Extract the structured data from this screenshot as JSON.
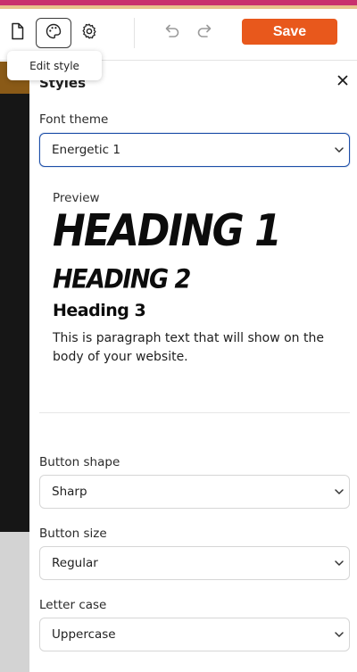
{
  "toolbar": {
    "icons": {
      "page": "page-icon",
      "palette": "palette-icon",
      "settings": "gear-icon",
      "undo": "undo-icon",
      "redo": "redo-icon"
    },
    "save_label": "Save",
    "tooltip": "Edit style"
  },
  "colors": {
    "accent": "#e8581c",
    "focus": "#1d4ea8"
  },
  "panel": {
    "title": "Styles",
    "font_theme": {
      "label": "Font theme",
      "value": "Energetic 1"
    },
    "preview": {
      "label": "Preview",
      "heading1": "HEADING 1",
      "heading2": "HEADING 2",
      "heading3": "Heading 3",
      "paragraph": "This is paragraph text that will show on the body of your website."
    },
    "button_shape": {
      "label": "Button shape",
      "value": "Sharp"
    },
    "button_size": {
      "label": "Button size",
      "value": "Regular"
    },
    "letter_case": {
      "label": "Letter case",
      "value": "Uppercase"
    }
  }
}
